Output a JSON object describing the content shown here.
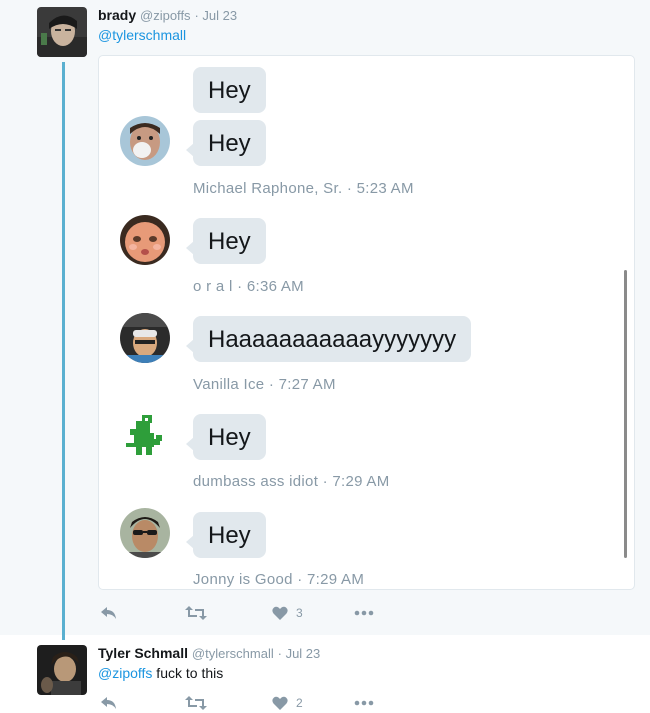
{
  "tweet1": {
    "name": "brady",
    "handle": "@zipoffs",
    "date": "Jul 23",
    "mention": "@tylerschmall",
    "like_count": "3"
  },
  "messages": [
    {
      "text": "Hey"
    },
    {
      "text": "Hey"
    },
    {
      "text": "Hey"
    },
    {
      "text": "Haaaaaaaaaaayyyyyyy"
    },
    {
      "text": "Hey"
    },
    {
      "text": "Hey"
    }
  ],
  "senders": [
    {
      "meta": "Michael Raphone, Sr. · 5:23 AM"
    },
    {
      "meta": "o r a l · 6:36 AM"
    },
    {
      "meta": "Vanilla Ice · 7:27 AM"
    },
    {
      "meta": "dumbass ass idiot · 7:29 AM"
    },
    {
      "meta": "Jonny is Good · 7:29 AM"
    }
  ],
  "tweet2": {
    "name": "Tyler Schmall",
    "handle": "@tylerschmall",
    "date": "Jul 23",
    "mention": "@zipoffs",
    "text": " fuck to this",
    "like_count": "2"
  },
  "icons": {
    "reply": "reply-icon",
    "retweet": "retweet-icon",
    "like": "heart-icon",
    "more": "more-icon"
  },
  "colors": {
    "link": "#1b95e0",
    "meta": "#8899a6",
    "bubble": "#e1e8ed",
    "thread_line": "#5ab0d0"
  }
}
